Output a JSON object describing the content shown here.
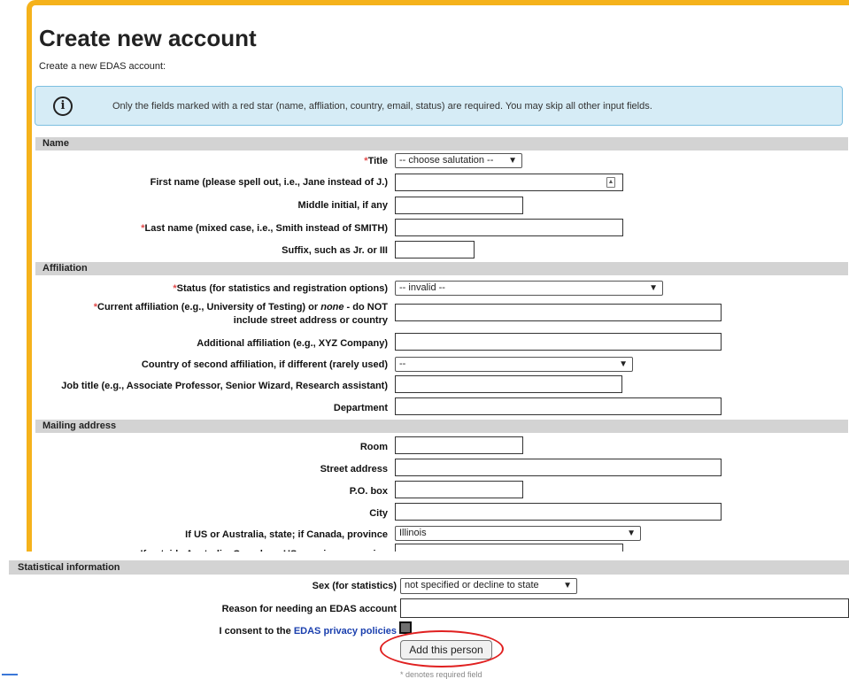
{
  "header": {
    "title": "Create new account",
    "subtitle": "Create a new EDAS account:"
  },
  "alert": {
    "icon": "info-icon",
    "message": "Only the fields marked with a red star (name, affliation, country, email, status) are required. You may skip all other input fields."
  },
  "sections": {
    "name": "Name",
    "affiliation": "Affiliation",
    "mailing": "Mailing address",
    "statistical": "Statistical information"
  },
  "name_fields": {
    "title_label": "Title",
    "title_value": "-- choose salutation --",
    "first_label": "First name (please spell out, i.e., Jane instead of J.)",
    "middle_label": "Middle initial, if any",
    "last_label": "Last name (mixed case, i.e., Smith instead of SMITH)",
    "suffix_label": "Suffix, such as Jr. or III"
  },
  "affiliation_fields": {
    "status_label": "Status (for statistics and registration options)",
    "status_value": "-- invalid --",
    "current_label_1": "Current affiliation (e.g., University of Testing) or ",
    "current_label_none": "none",
    "current_label_2": " - do NOT",
    "current_label_3": "include street address or country",
    "additional_label": "Additional affiliation (e.g., XYZ Company)",
    "country2_label": "Country of second affiliation, if different (rarely used)",
    "country2_value": "--",
    "job_label": "Job title (e.g., Associate Professor, Senior Wizard, Research assistant)",
    "department_label": "Department"
  },
  "mailing_fields": {
    "room_label": "Room",
    "street_label": "Street address",
    "pobox_label": "P.O. box",
    "city_label": "City",
    "state_label": "If US or Australia, state; if Canada, province",
    "state_value": "Illinois",
    "outside_label": "If outside Australia, Canada or US, province or region"
  },
  "stat_fields": {
    "sex_label": "Sex (for statistics)",
    "sex_value": "not specified or decline to state",
    "reason_label": "Reason for needing an EDAS account",
    "consent_prefix": "I consent to the ",
    "consent_link": "EDAS privacy policies",
    "submit_label": "Add this person",
    "footnote": "* denotes required field"
  },
  "colors": {
    "accent": "#f5b21b",
    "alert_bg": "#d6ecf6",
    "required_star": "#e24a4a",
    "highlight_circle": "#e02020"
  }
}
